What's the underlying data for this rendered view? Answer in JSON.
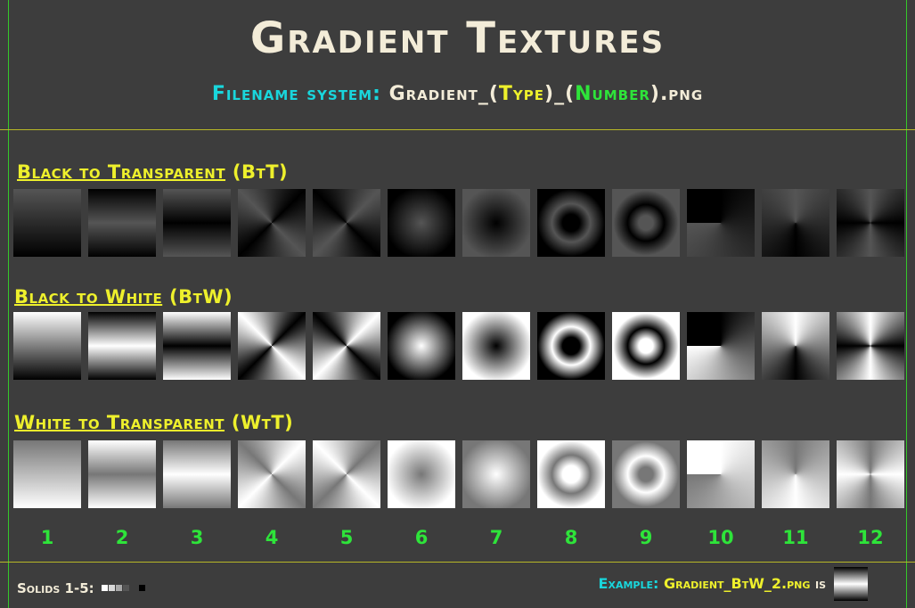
{
  "header": {
    "title": "Gradient Textures",
    "filename_prefix": "Filename system:",
    "filename_a": "Gradient_(",
    "filename_type": "Type",
    "filename_b": ")_(",
    "filename_number": "Number",
    "filename_c": ").png"
  },
  "sections": [
    {
      "label": "Black to Transparent",
      "code": "(BtT)"
    },
    {
      "label": "Black to White",
      "code": "(BtW)"
    },
    {
      "label": "White to Transparent",
      "code": "(WtT)"
    }
  ],
  "numbers": [
    "1",
    "2",
    "3",
    "4",
    "5",
    "6",
    "7",
    "8",
    "9",
    "10",
    "11",
    "12"
  ],
  "footer": {
    "solids_label": "Solids 1-5:",
    "example_label": "Example:",
    "example_file": "Gradient_BtW_2.png",
    "example_is": "is"
  },
  "colors": {
    "background": "#3d3d3d",
    "title": "#f3ecd8",
    "cyan": "#19d6dc",
    "yellow": "#eef02c",
    "green": "#2ee43a",
    "divider": "#b8b827",
    "border": "#35c82a"
  }
}
